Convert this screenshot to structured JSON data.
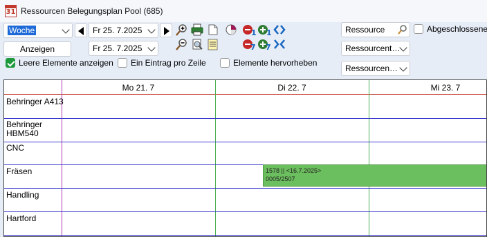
{
  "window": {
    "title": "Ressourcen Belegungsplan Pool  (685)",
    "icon_text": "31"
  },
  "toolbar": {
    "view_select": "Woche",
    "date_from": "Fr 25.  7.2025",
    "date_to": "Fr 25.  7.2025",
    "show_button": "Anzeigen",
    "resource_search": "Ressource",
    "resource_type_select": "Ressourcent…",
    "resource_group_select": "Ressourcen…",
    "completed_label": "Abgeschlossene",
    "completed_checked": false,
    "show_empty_label": "Leere Elemente anzeigen",
    "show_empty_checked": true,
    "one_entry_label": "Ein Eintrag pro Zeile",
    "one_entry_checked": false,
    "highlight_label": "Elemente hervorheben",
    "highlight_checked": false
  },
  "schedule": {
    "days": [
      "Mo 21.  7",
      "Di 22.  7",
      "Mi 23.  7"
    ],
    "resources": [
      "Behringer A413",
      "Behringer\nHBM540",
      "CNC",
      "Fräsen",
      "Handling",
      "Hartford"
    ],
    "event": {
      "line1": "1578 || <16.7.2025>",
      "line2": "0005/2507",
      "color": "#6cbf5e"
    }
  },
  "colors": {
    "row_line": "#3b3bcc",
    "day_line": "#4caf50",
    "today_line": "#b03ab0",
    "header_line": "#c0392b"
  }
}
